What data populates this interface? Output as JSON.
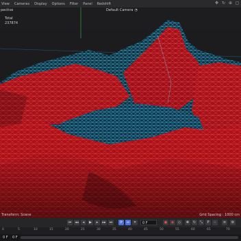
{
  "menubar": {
    "items": [
      "View",
      "Cameras",
      "Display",
      "Options",
      "Filter",
      "Panel",
      "Redshift"
    ]
  },
  "viewport": {
    "projection_label": "pective",
    "camera_label": "Default Camera",
    "stats": {
      "total_label": "Total",
      "count_value": "237874"
    },
    "transform_label": "Transform: Scene",
    "grid_spacing": "Grid Spacing : 1000 cm"
  },
  "colors": {
    "mesh_fill": "#c0121a",
    "wire_red": "#ff4a4a",
    "wire_cyan": "#3fd0ff",
    "ground": "#1f3f5a"
  },
  "timeline": {
    "current_frame": "0 F",
    "field_right": "0",
    "ticks": [
      "0",
      "5",
      "10",
      "15",
      "20",
      "25",
      "30",
      "35",
      "40",
      "45",
      "50",
      "55",
      "60",
      "65",
      "70"
    ],
    "start_frame": "0 F",
    "end_frame": "0 F"
  }
}
